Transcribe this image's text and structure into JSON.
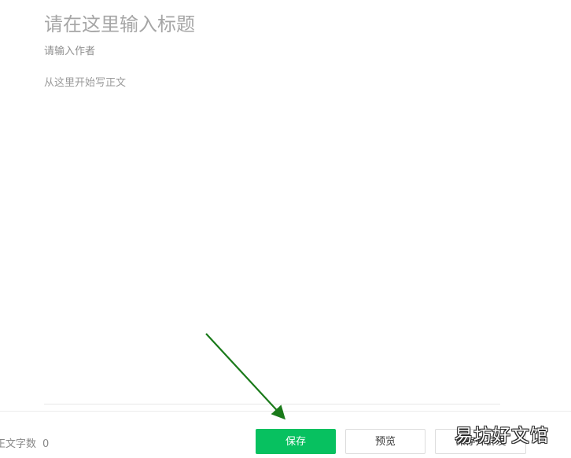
{
  "editor": {
    "title_placeholder": "请在这里输入标题",
    "author_placeholder": "请输入作者",
    "body_placeholder": "从这里开始写正文"
  },
  "toolbar": {
    "word_count_label": "正文字数",
    "word_count_value": "0",
    "save_label": "保存",
    "preview_label": "预览",
    "publish_label": "保存并群发"
  },
  "watermark": {
    "text": "易坊好文馆"
  },
  "colors": {
    "accent_green": "#07c160",
    "annotation_arrow": "#1a7a1a"
  }
}
